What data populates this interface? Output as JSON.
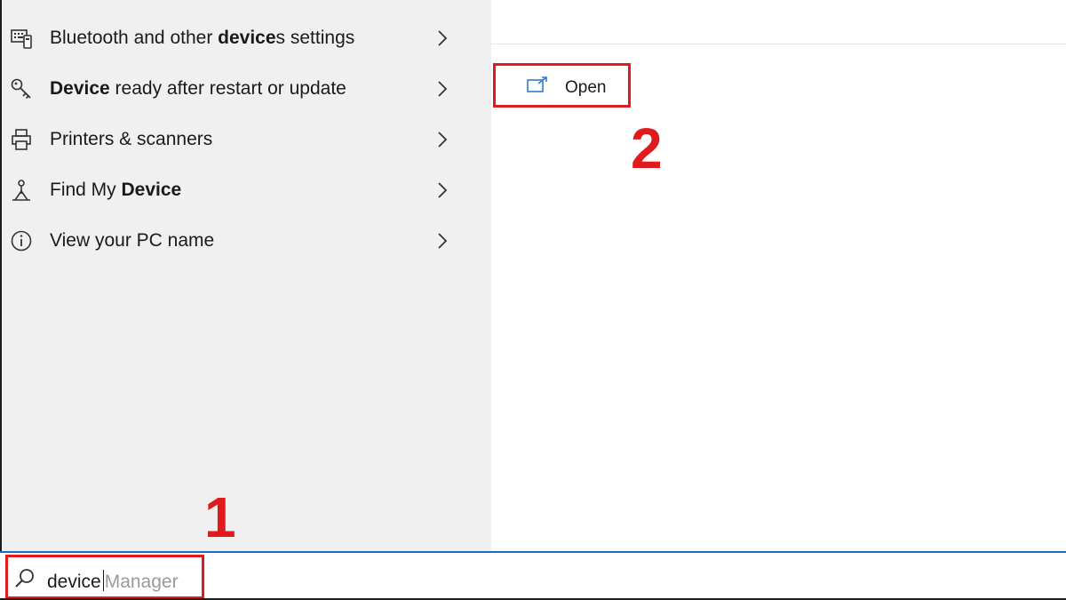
{
  "results": [
    {
      "icon": "keyboard-settings-icon",
      "label_pre": "Bluetooth and other ",
      "label_bold": "device",
      "label_post": "s settings"
    },
    {
      "icon": "key-icon",
      "label_pre": "",
      "label_bold": "Device",
      "label_post": " ready after restart or update"
    },
    {
      "icon": "printer-icon",
      "label_pre": "Printers & scanners",
      "label_bold": "",
      "label_post": ""
    },
    {
      "icon": "find-device-icon",
      "label_pre": "Find My ",
      "label_bold": "Device",
      "label_post": ""
    },
    {
      "icon": "info-icon",
      "label_pre": "View your PC name",
      "label_bold": "",
      "label_post": ""
    }
  ],
  "action": {
    "label": "Open",
    "icon": "open-external-icon"
  },
  "steps": {
    "first": "1",
    "second": "2"
  },
  "search": {
    "typed": "device",
    "suggestion": "Manager",
    "icon": "search-icon"
  },
  "colors": {
    "highlight": "#e01b1b",
    "accent_line": "#1f6fb5",
    "pane_bg": "#f0f0f0"
  }
}
